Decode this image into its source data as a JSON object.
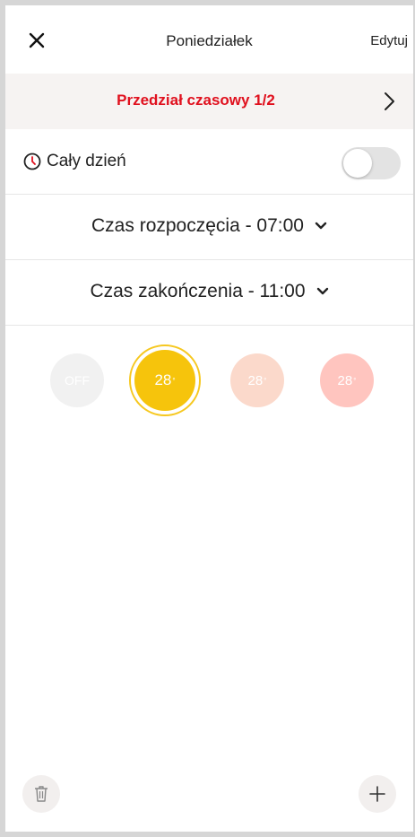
{
  "topbar": {
    "title": "Poniedziałek",
    "edit_label": "Edytuj",
    "close_icon": "close-icon"
  },
  "slot": {
    "title": "Przedział czasowy 1/2",
    "title_color": "#e0101e",
    "next_icon": "chevron-right-icon"
  },
  "all_day": {
    "label": "Cały dzień",
    "icon": "clock-icon",
    "enabled": false
  },
  "start_time": {
    "label": "Czas rozpoczęcia - 07:00"
  },
  "end_time": {
    "label": "Czas zakończenia - 11:00"
  },
  "modes": {
    "off_label": "OFF",
    "items": [
      {
        "value": "28",
        "unit": "°",
        "color": "#f6c40c",
        "selected": true
      },
      {
        "value": "28",
        "unit": "°",
        "color": "#fbd9cb",
        "selected": false
      },
      {
        "value": "28",
        "unit": "°",
        "color": "#ffc5bf",
        "selected": false
      }
    ]
  },
  "bottom": {
    "delete_icon": "trash-icon",
    "add_icon": "plus-icon"
  }
}
